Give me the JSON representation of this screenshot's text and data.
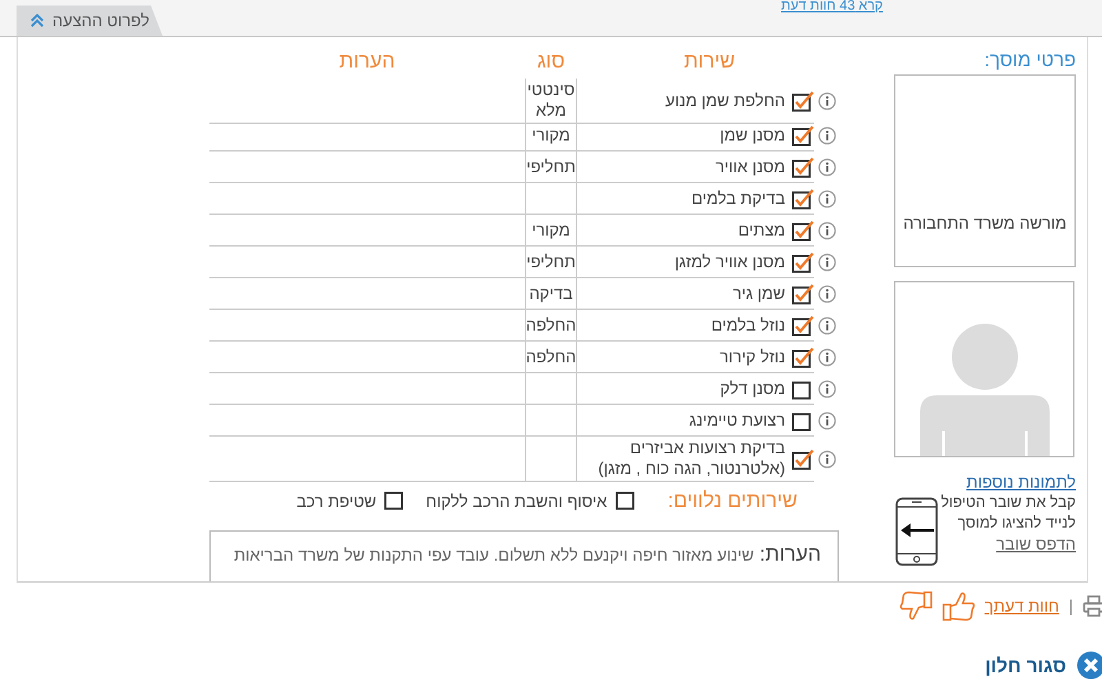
{
  "top_link": "קרא 43 חוות דעת",
  "tab": {
    "label": "לפרוט ההצעה"
  },
  "table": {
    "columns": [
      "שירות",
      "סוג",
      "הערות"
    ],
    "rows": [
      {
        "service": "החלפת שמן מנוע",
        "checked": true,
        "type": "סינטטי מלא"
      },
      {
        "service": "מסנן שמן",
        "checked": true,
        "type": "מקורי"
      },
      {
        "service": "מסנן אוויר",
        "checked": true,
        "type": "תחליפי"
      },
      {
        "service": "בדיקת בלמים",
        "checked": true
      },
      {
        "service": "מצתים",
        "checked": true,
        "type": "מקורי"
      },
      {
        "service": "מסנן אוויר למזגן",
        "checked": true,
        "type": "תחליפי"
      },
      {
        "service": "שמן גיר",
        "checked": true,
        "type": "בדיקה"
      },
      {
        "service": "נוזל בלמים",
        "checked": true,
        "type": "החלפה"
      },
      {
        "service": "נוזל קירור",
        "checked": true,
        "type": "החלפה"
      },
      {
        "service": "מסנן דלק",
        "checked": false
      },
      {
        "service": "רצועת טיימינג",
        "checked": false
      },
      {
        "service": "בדיקת רצועות אביזרים (אלטרנטור, הגה כוח , מזגן)",
        "checked": true
      }
    ]
  },
  "extras": {
    "title": "שירותים נלווים:",
    "options": [
      {
        "label": "איסוף והשבת הרכב ללקוח",
        "checked": false
      },
      {
        "label": "שטיפת רכב",
        "checked": false
      }
    ]
  },
  "notes": {
    "label": "הערות:",
    "text": "שינוע מאזור חיפה ויקנעם ללא תשלום. עובד עפי התקנות של משרד הבריאות"
  },
  "garage": {
    "title": "פרטי מוסך:",
    "license": "מורשה משרד התחבורה",
    "more_photos": "לתמונות נוספות",
    "voucher_text": "קבל את שובר הטיפול לנייד להציגו למוסך",
    "print_voucher": "הדפס שובר"
  },
  "footer": {
    "separator": "|",
    "feedback_link": "חוות דעתך",
    "close": "סגור חלון"
  }
}
